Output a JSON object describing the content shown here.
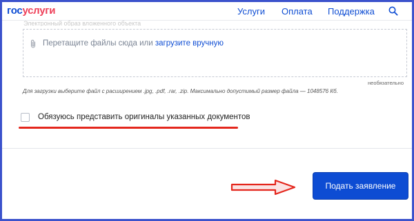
{
  "header": {
    "logo_part1": "гос",
    "logo_part2": "услуги",
    "nav": {
      "services": "Услуги",
      "payment": "Оплата",
      "support": "Поддержка"
    },
    "search_icon": "search-icon"
  },
  "upload": {
    "faint_label": "Электронный образ вложенного объекта",
    "drop_text": "Перетащите файлы сюда или ",
    "drop_link": "загрузите вручную",
    "optional_note": "необязательно",
    "hint": "Для загрузки выберите файл с расширением .jpg, .pdf, .rar, .zip. Максимально допустимый размер файла — 1048576 Кб."
  },
  "commitment": {
    "checked": false,
    "label": "Обязуюсь представить оригиналы указанных документов"
  },
  "actions": {
    "submit_label": "Подать заявление"
  },
  "colors": {
    "brand_blue": "#0d4cd3",
    "brand_red": "#ee3f58",
    "annotation_red": "#e4261c",
    "frame_blue": "#3b52cc"
  }
}
